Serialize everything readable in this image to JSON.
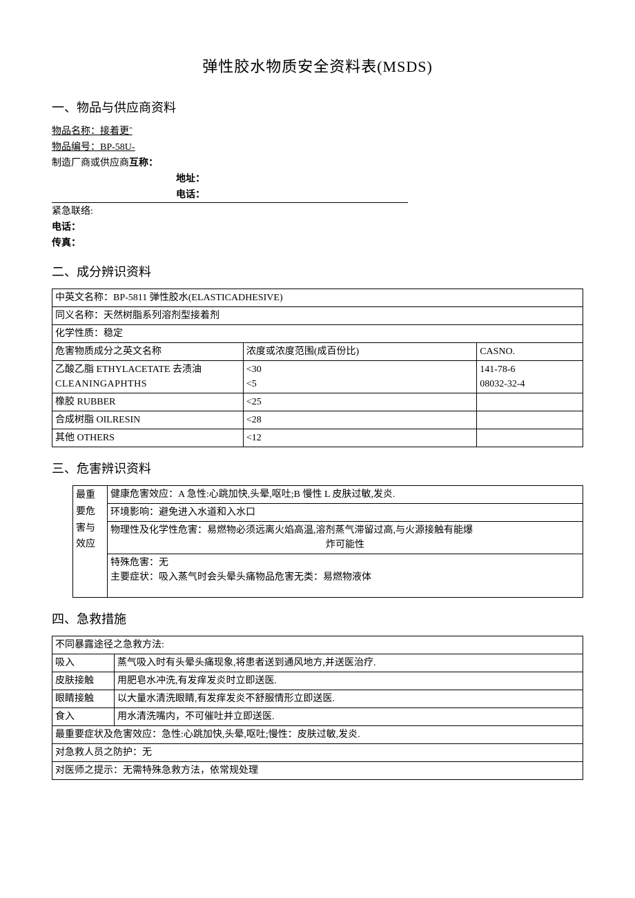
{
  "title": "弹性胶水物质安全资料表(MSDS)",
  "sec1": {
    "heading": "一、物品与供应商资料",
    "item_name_label": "物品名称：",
    "item_name_value": "接着更ˆ",
    "item_code_label": "物品编号：",
    "item_code_value": "BP-58U-",
    "mfg_label": "制造厂商或供应商",
    "mfg_bold": "互称：",
    "addr_bold": "地址：",
    "tel_bold": "电话：",
    "emergency_label": "紧急联络:",
    "phone_bold": "电话：",
    "fax_bold": "传真："
  },
  "sec2": {
    "heading": "二、成分辨识资料",
    "row_fullname": "中英文名称：BP-5811 弹性胶水(ELASTICADHESIVE)",
    "row_synonym": "同义名称：天然树脂系列溶剂型接着剂",
    "row_chem": "化学性质：稳定",
    "hdr_name": "危害物质成分之英文名称",
    "hdr_conc": "浓度或浓度范围(成百份比)",
    "hdr_cas": "CASNO.",
    "r1c1a": "乙酸乙脂 ETHYLACETATE 去渍油",
    "r1c1b": "CLEANINGAPHTHS",
    "r1c2a": "<30",
    "r1c2b": "<5",
    "r1c3a": "141-78-6",
    "r1c3b": "08032-32-4",
    "r2c1": "橡胶 RUBBER",
    "r2c2": "<25",
    "r2c3": "",
    "r3c1": "合成树脂 OILRESIN",
    "r3c2": "<28",
    "r3c3": "",
    "r4c1": "其他 OTHERS",
    "r4c2": "<12",
    "r4c3": ""
  },
  "sec3": {
    "heading": "三、危害辨识资料",
    "side_label": "最重要危害与效应",
    "row1": "健康危害效应：A 急性:心跳加快,头晕,呕吐;B 慢性 L 皮肤过敏,发炎.",
    "row2": "环境影响：避免进入水道和入水口",
    "row3a": "物理性及化学性危害：易燃物必须远离火焰高温,溶剂蒸气滞留过高,与火源接触有能爆",
    "row3b": "炸可能性",
    "row4a": "特殊危害：无",
    "row4b": "主要症状：吸入蒸气时会头晕头痛物品危害无类：易燃物液体"
  },
  "sec4": {
    "heading": "四、急救措施",
    "top": "不同暴露途径之急救方法:",
    "r1a": "吸入",
    "r1b": "蒸气吸入时有头晕头痛现象,将患者送到通风地方,并送医治疗.",
    "r2a": "皮肤接触",
    "r2b": "用肥皂水冲洗,有发痒发炎时立即送医.",
    "r3a": "眼睛接触",
    "r3b": "以大量水清洗眼睛,有发痒发炎不舒服情形立即送医.",
    "r4a": "食入",
    "r4b": "用水清洗嘴内，不可催吐并立即送医.",
    "row5": "最重要症状及危害效应：急性:心跳加快,头晕,呕吐;慢性：皮肤过敏,发炎.",
    "row6": "对急救人员之防护：无",
    "row7": "对医师之提示：无需特殊急救方法，依常规处理"
  }
}
